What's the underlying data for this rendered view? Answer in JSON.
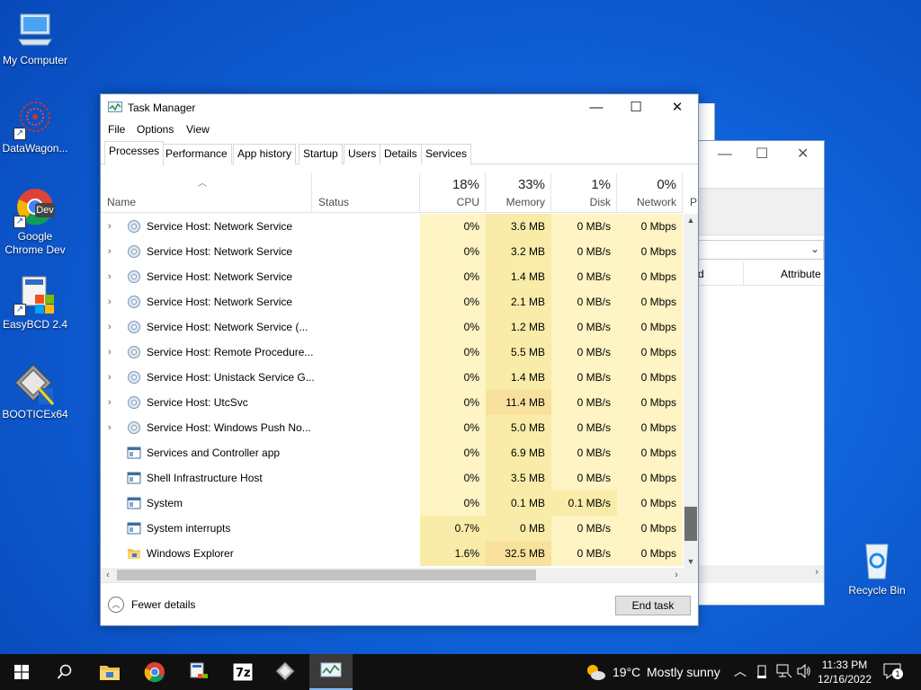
{
  "desktop": {
    "icons": [
      {
        "label": "My Computer"
      },
      {
        "label": "DataWagon..."
      },
      {
        "label": "Google Chrome Dev"
      },
      {
        "label": "EasyBCD 2.4"
      },
      {
        "label": "BOOTICEx64"
      },
      {
        "label": "Recycle Bin"
      }
    ],
    "chrome_badge": "Dev"
  },
  "background_window": {
    "column_partial": "d",
    "column_attribute": "Attribute"
  },
  "task_manager": {
    "title": "Task Manager",
    "menu": [
      "File",
      "Options",
      "View"
    ],
    "tabs": [
      "Processes",
      "Performance",
      "App history",
      "Startup",
      "Users",
      "Details",
      "Services"
    ],
    "active_tab": "Processes",
    "columns": {
      "name": "Name",
      "status": "Status",
      "cpu": {
        "pct": "18%",
        "label": "CPU"
      },
      "memory": {
        "pct": "33%",
        "label": "Memory"
      },
      "disk": {
        "pct": "1%",
        "label": "Disk"
      },
      "network": {
        "pct": "0%",
        "label": "Network"
      },
      "partial": "P"
    },
    "rows": [
      {
        "expand": true,
        "name": "Service Host: Network Service",
        "cpu": "0%",
        "memory": "3.6 MB",
        "disk": "0 MB/s",
        "network": "0 Mbps"
      },
      {
        "expand": true,
        "name": "Service Host: Network Service",
        "cpu": "0%",
        "memory": "3.2 MB",
        "disk": "0 MB/s",
        "network": "0 Mbps"
      },
      {
        "expand": true,
        "name": "Service Host: Network Service",
        "cpu": "0%",
        "memory": "1.4 MB",
        "disk": "0 MB/s",
        "network": "0 Mbps"
      },
      {
        "expand": true,
        "name": "Service Host: Network Service",
        "cpu": "0%",
        "memory": "2.1 MB",
        "disk": "0 MB/s",
        "network": "0 Mbps"
      },
      {
        "expand": true,
        "name": "Service Host: Network Service (...",
        "cpu": "0%",
        "memory": "1.2 MB",
        "disk": "0 MB/s",
        "network": "0 Mbps"
      },
      {
        "expand": true,
        "name": "Service Host: Remote Procedure...",
        "cpu": "0%",
        "memory": "5.5 MB",
        "disk": "0 MB/s",
        "network": "0 Mbps"
      },
      {
        "expand": true,
        "name": "Service Host: Unistack Service G...",
        "cpu": "0%",
        "memory": "1.4 MB",
        "disk": "0 MB/s",
        "network": "0 Mbps"
      },
      {
        "expand": true,
        "name": "Service Host: UtcSvc",
        "cpu": "0%",
        "memory": "11.4 MB",
        "disk": "0 MB/s",
        "network": "0 Mbps"
      },
      {
        "expand": true,
        "name": "Service Host: Windows Push No...",
        "cpu": "0%",
        "memory": "5.0 MB",
        "disk": "0 MB/s",
        "network": "0 Mbps"
      },
      {
        "expand": false,
        "name": "Services and Controller app",
        "cpu": "0%",
        "memory": "6.9 MB",
        "disk": "0 MB/s",
        "network": "0 Mbps"
      },
      {
        "expand": false,
        "name": "Shell Infrastructure Host",
        "cpu": "0%",
        "memory": "3.5 MB",
        "disk": "0 MB/s",
        "network": "0 Mbps"
      },
      {
        "expand": false,
        "name": "System",
        "cpu": "0%",
        "memory": "0.1 MB",
        "disk": "0.1 MB/s",
        "network": "0 Mbps"
      },
      {
        "expand": false,
        "name": "System interrupts",
        "cpu": "0.7%",
        "memory": "0 MB",
        "disk": "0 MB/s",
        "network": "0 Mbps"
      },
      {
        "expand": false,
        "name": "Windows Explorer",
        "cpu": "1.6%",
        "memory": "32.5 MB",
        "disk": "0 MB/s",
        "network": "0 Mbps"
      }
    ],
    "fewer_details": "Fewer details",
    "end_task": "End task"
  },
  "taskbar": {
    "weather_temp": "19°C",
    "weather_text": "Mostly sunny",
    "time": "11:33 PM",
    "date": "12/16/2022",
    "notification_count": "1"
  },
  "colors": {
    "heat_light": "#fff4c4",
    "heat_medium": "#f9eca8",
    "heat_strong": "#f7e19c",
    "accent": "#0078d7"
  }
}
